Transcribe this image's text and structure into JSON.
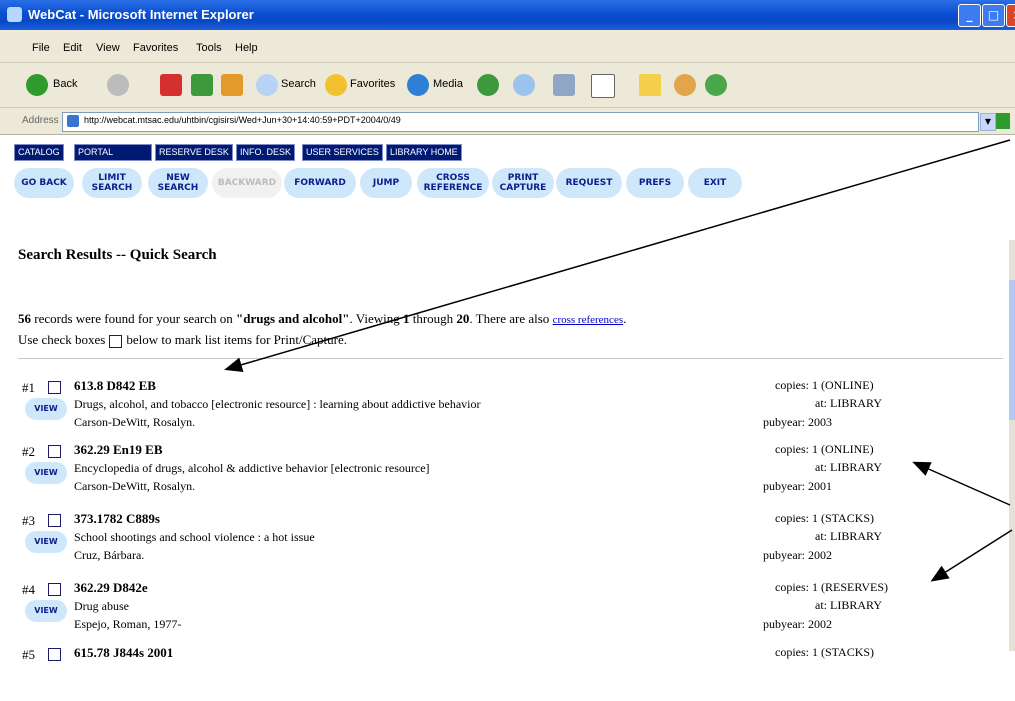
{
  "window": {
    "title": "WebCat - Microsoft Internet Explorer"
  },
  "menu": [
    "File",
    "Edit",
    "View",
    "Favorites",
    "Tools",
    "Help"
  ],
  "toolbar": {
    "back": "Back",
    "search": "Search",
    "favorites": "Favorites",
    "media": "Media"
  },
  "address": {
    "label": "Address",
    "url": "http://webcat.mtsac.edu/uhtbin/cgisirsi/Wed+Jun+30+14:40:59+PDT+2004/0/49",
    "go": "Go"
  },
  "nav_tabs": [
    "CATALOG",
    "PORTAL",
    "RESERVE DESK",
    "INFO. DESK",
    "USER SERVICES",
    "LIBRARY HOME"
  ],
  "nav_buttons": [
    {
      "label": "GO BACK",
      "disabled": false
    },
    {
      "label": "LIMIT SEARCH",
      "disabled": false
    },
    {
      "label": "NEW SEARCH",
      "disabled": false
    },
    {
      "label": "BACKWARD",
      "disabled": true
    },
    {
      "label": "FORWARD",
      "disabled": false
    },
    {
      "label": "JUMP",
      "disabled": false
    },
    {
      "label": "CROSS REFERENCE",
      "disabled": false
    },
    {
      "label": "PRINT CAPTURE",
      "disabled": false
    },
    {
      "label": "REQUEST",
      "disabled": false
    },
    {
      "label": "PREFS",
      "disabled": false
    },
    {
      "label": "EXIT",
      "disabled": false
    }
  ],
  "heading": "Search Results -- Quick Search",
  "summary": {
    "count": "56",
    "t1": " records were found for your search on ",
    "query": "\"drugs and alcohol\"",
    "t2": ". Viewing ",
    "from": "1",
    "t3": " through ",
    "to": "20",
    "t4": ". There are also ",
    "link": "cross references",
    "t5": "."
  },
  "instruction": {
    "before": "Use check boxes",
    "after": "below to mark list items for Print/Capture."
  },
  "view_label": "VIEW",
  "records": [
    {
      "num": "#1",
      "call": "613.8 D842 EB",
      "title": "Drugs, alcohol, and tobacco [electronic resource] : learning about addictive behavior",
      "author": "Carson-DeWitt, Rosalyn.",
      "copies": "copies: 1 (ONLINE)",
      "at": "at: LIBRARY",
      "pubyear": "pubyear: 2003"
    },
    {
      "num": "#2",
      "call": "362.29 En19 EB",
      "title": "Encyclopedia of drugs, alcohol & addictive behavior [electronic resource]",
      "author": "Carson-DeWitt, Rosalyn.",
      "copies": "copies: 1 (ONLINE)",
      "at": "at: LIBRARY",
      "pubyear": "pubyear: 2001"
    },
    {
      "num": "#3",
      "call": "373.1782 C889s",
      "title": "School shootings and school violence : a hot issue",
      "author": "Cruz, Bárbara.",
      "copies": "copies: 1 (STACKS)",
      "at": "at: LIBRARY",
      "pubyear": "pubyear: 2002"
    },
    {
      "num": "#4",
      "call": "362.29 D842e",
      "title": "Drug abuse",
      "author": "Espejo, Roman, 1977-",
      "copies": "copies: 1 (RESERVES)",
      "at": "at: LIBRARY",
      "pubyear": "pubyear: 2002"
    },
    {
      "num": "#5",
      "call": "615.78 J844s 2001",
      "title": "",
      "author": "",
      "copies": "copies: 1 (STACKS)",
      "at": "",
      "pubyear": ""
    }
  ]
}
